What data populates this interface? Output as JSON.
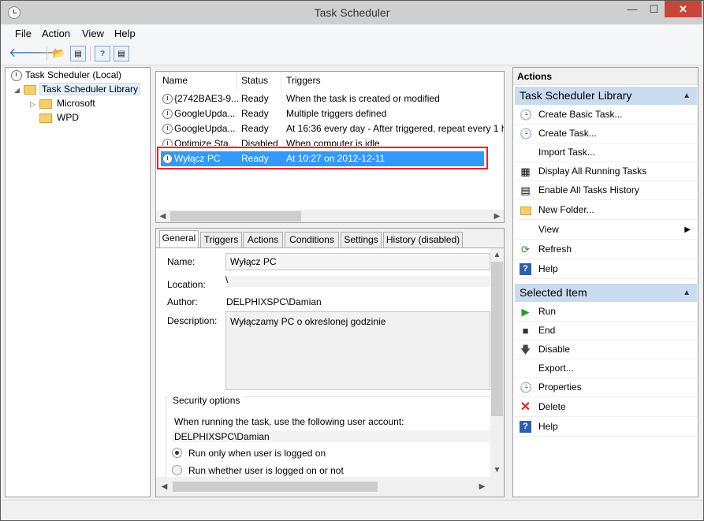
{
  "window": {
    "title": "Task Scheduler",
    "min": "—",
    "max": "☐",
    "close": "✕"
  },
  "menu": [
    "File",
    "Action",
    "View",
    "Help"
  ],
  "toolbar": {
    "back": "🡐",
    "forward": "🡒",
    "up": "📂",
    "show_hide": "▤",
    "help": "?",
    "pane": "▤"
  },
  "tree": {
    "root": "Task Scheduler (Local)",
    "library": "Task Scheduler Library",
    "children": [
      "Microsoft",
      "WPD"
    ]
  },
  "list": {
    "headers": [
      "Name",
      "Status",
      "Triggers"
    ],
    "rows": [
      {
        "name": "{2742BAE3-9...",
        "status": "Ready",
        "trigger": "When the task is created or modified"
      },
      {
        "name": "GoogleUpda...",
        "status": "Ready",
        "trigger": "Multiple triggers defined"
      },
      {
        "name": "GoogleUpda...",
        "status": "Ready",
        "trigger": "At 16:36 every day - After triggered, repeat every 1 ho"
      },
      {
        "name": "Optimize Sta...",
        "status": "Disabled",
        "trigger": "When computer is idle"
      },
      {
        "name": "Wyłącz PC",
        "status": "Ready",
        "trigger": "At 10:27 on 2012-12-11"
      }
    ],
    "selected_index": 4
  },
  "tabs": [
    "General",
    "Triggers",
    "Actions",
    "Conditions",
    "Settings",
    "History (disabled)"
  ],
  "general": {
    "name_label": "Name:",
    "name": "Wyłącz PC",
    "location_label": "Location:",
    "location": "\\",
    "author_label": "Author:",
    "author": "DELPHIXSPC\\Damian",
    "description_label": "Description:",
    "description": "Wyłączamy PC o określonej godzinie",
    "security_legend": "Security options",
    "account_prompt": "When running the task, use the following user account:",
    "account": "DELPHIXSPC\\Damian",
    "radio_logged_on": "Run only when user is logged on",
    "radio_whether": "Run whether user is logged on or not"
  },
  "actions": {
    "header": "Actions",
    "library_section": "Task Scheduler Library",
    "library_items": [
      "Create Basic Task...",
      "Create Task...",
      "Import Task...",
      "Display All Running Tasks",
      "Enable All Tasks History",
      "New Folder...",
      "View",
      "Refresh",
      "Help"
    ],
    "selected_section": "Selected Item",
    "selected_items": [
      "Run",
      "End",
      "Disable",
      "Export...",
      "Properties",
      "Delete",
      "Help"
    ]
  },
  "colors": {
    "selection": "#3399ff",
    "highlight_box": "#e8232a",
    "section_header": "#c9dcef",
    "close_button": "#c7463a"
  }
}
